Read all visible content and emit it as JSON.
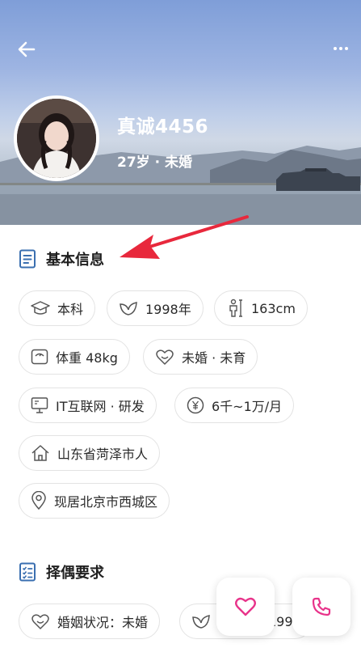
{
  "profile": {
    "nickname": "真诚4456",
    "summary": "27岁 · 未婚"
  },
  "basic_info": {
    "title": "基本信息",
    "tags": [
      {
        "icon": "graduation-cap-icon",
        "label": "本科"
      },
      {
        "icon": "leaf-icon",
        "label": "1998年"
      },
      {
        "icon": "height-person-icon",
        "label": "163cm"
      },
      {
        "icon": "weight-scale-icon",
        "label": "体重 48kg"
      },
      {
        "icon": "hearts-icon",
        "label": "未婚 · 未育"
      },
      {
        "icon": "monitor-icon",
        "label": "IT互联网 · 研发"
      },
      {
        "icon": "yuan-coin-icon",
        "label": "6千~1万/月"
      },
      {
        "icon": "house-icon",
        "label": "山东省菏泽市人"
      },
      {
        "icon": "location-pin-icon",
        "label": "现居北京市西城区"
      }
    ]
  },
  "partner_requirements": {
    "title": "择偶要求",
    "tags": [
      {
        "icon": "hearts-icon",
        "label": "婚姻状况：未婚"
      },
      {
        "icon": "leaf-icon",
        "label": "199"
      }
    ]
  },
  "actions": {
    "like_icon": "heart-icon",
    "call_icon": "phone-icon"
  },
  "colors": {
    "accent_pink": "#e8338a",
    "annotation_red": "#e8283c",
    "icon_blue": "#3a6fb0"
  }
}
